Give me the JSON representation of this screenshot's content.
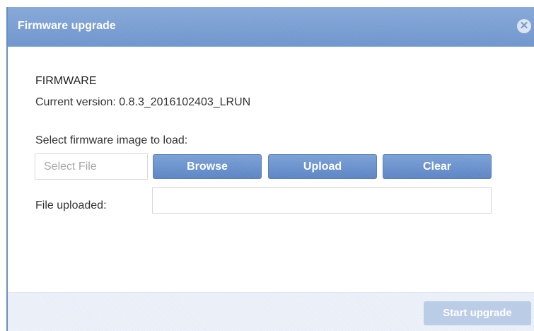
{
  "dialog": {
    "title": "Firmware upgrade",
    "close_icon": "close-circle-icon"
  },
  "firmware": {
    "section_title": "FIRMWARE",
    "current_version_label": "Current version:",
    "current_version_value": "0.8.3_2016102403_LRUN",
    "select_label": "Select firmware image to load:",
    "file_placeholder": "Select File",
    "browse_label": "Browse",
    "upload_label": "Upload",
    "clear_label": "Clear",
    "uploaded_label": "File uploaded:",
    "uploaded_value": ""
  },
  "footer": {
    "start_upgrade_label": "Start upgrade"
  }
}
